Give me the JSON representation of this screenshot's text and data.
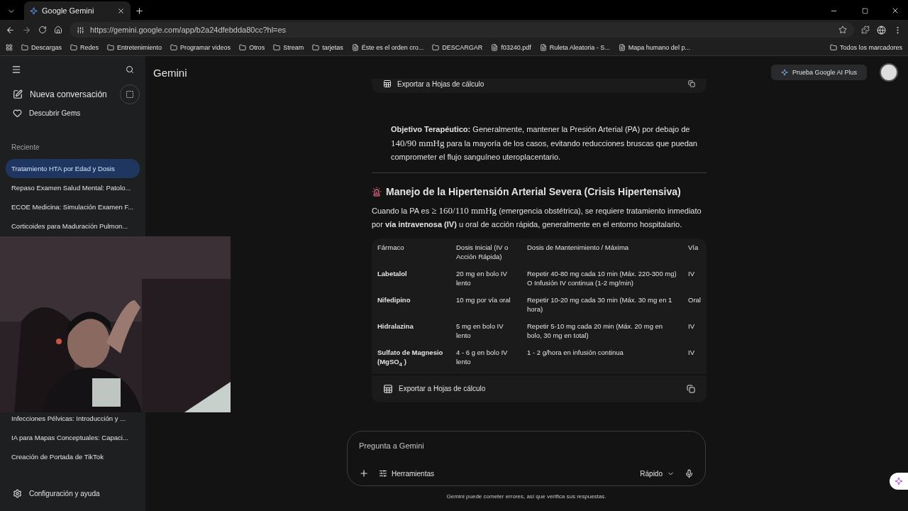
{
  "browser": {
    "tab_title": "Google Gemini",
    "url": "https://gemini.google.com/app/b2a24dfebdda80cc?hl=es",
    "bookmarks": [
      {
        "label": "Descargas",
        "kind": "folder"
      },
      {
        "label": "Redes",
        "kind": "folder"
      },
      {
        "label": "Entretenimiento",
        "kind": "folder"
      },
      {
        "label": "Programar videos",
        "kind": "folder"
      },
      {
        "label": "Otros",
        "kind": "folder"
      },
      {
        "label": "Stream",
        "kind": "folder"
      },
      {
        "label": "tarjetas",
        "kind": "folder"
      },
      {
        "label": "Éste es el orden cro...",
        "kind": "page"
      },
      {
        "label": "DESCARGAR",
        "kind": "folder"
      },
      {
        "label": "f03240.pdf",
        "kind": "page"
      },
      {
        "label": "Ruleta Aleatoria - S...",
        "kind": "page"
      },
      {
        "label": "Mapa humano del p...",
        "kind": "page"
      }
    ],
    "all_bookmarks": "Todos los marcadores"
  },
  "sidebar": {
    "new_chat": "Nueva conversación",
    "discover": "Descubrir Gems",
    "recent_label": "Reciente",
    "recent": [
      {
        "title": "Tratamiento HTA por Edad y Dosis",
        "selected": true
      },
      {
        "title": "Repaso Examen Salud Mental: Patolo...",
        "selected": false
      },
      {
        "title": "ECOE Medicina: Simulación Examen F...",
        "selected": false
      },
      {
        "title": "Corticoides para Maduración Pulmon...",
        "selected": false
      },
      {
        "title": "Infecciones Pélvicas: Introducción y ...",
        "selected": false
      },
      {
        "title": "IA para Mapas Conceptuales: Capaci...",
        "selected": false
      },
      {
        "title": "Creación de Portada de TikTok",
        "selected": false
      }
    ],
    "settings": "Configuración y ayuda"
  },
  "header": {
    "title": "Gemini",
    "upgrade": "Prueba Google AI Plus"
  },
  "content": {
    "export_top": "Exportar a Hojas de cálculo",
    "objective": [
      {
        "kind": "bold",
        "text": "Objetivo Terapéutico:"
      },
      {
        "kind": "text",
        "text": " Generalmente, mantener la Presión Arterial (PA) por debajo de "
      },
      {
        "kind": "math",
        "text": "140/90 mmHg"
      },
      {
        "kind": "text",
        "text": " para la mayoría de los casos, evitando reducciones bruscas que puedan comprometer el flujo sanguíneo uteroplacentario."
      }
    ],
    "heading": "Manejo de la Hipertensión Arterial Severa (Crisis Hipertensiva)",
    "intro": [
      {
        "kind": "text",
        "text": "Cuando la PA es "
      },
      {
        "kind": "math",
        "text": "≥ 160/110 mmHg"
      },
      {
        "kind": "text",
        "text": " (emergencia obstétrica), se requiere tratamiento inmediato por "
      },
      {
        "kind": "bold",
        "text": "vía intravenosa (IV)"
      },
      {
        "kind": "text",
        "text": " u oral de acción rápida, generalmente en el entorno hospitalario."
      }
    ],
    "table": {
      "columns": [
        "Fármaco",
        "Dosis Inicial (IV o Acción Rápida)",
        "Dosis de Mantenimiento / Máxima",
        "Vía"
      ],
      "rows": [
        [
          "Labetalol",
          "20 mg en bolo IV lento",
          "Repetir 40-80 mg cada 10 min (Máx. 220-300 mg) O Infusión IV continua (1-2 mg/min)",
          "IV"
        ],
        [
          "Nifedipino",
          "10 mg por vía oral",
          "Repetir 10-20 mg cada 30 min (Máx. 30 mg en 1 hora)",
          "Oral"
        ],
        [
          "Hidralazina",
          "5 mg en bolo IV lento",
          "Repetir 5-10 mg cada 20 min (Máx. 20 mg en bolo, 30 mg en total)",
          "IV"
        ],
        [
          "Sulfato de Magnesio (MgSO$_{4}$ )",
          "4 - 6 g en bolo IV lento",
          "1 - 2 g/hora en infusión continua",
          "IV"
        ]
      ]
    },
    "export": "Exportar a Hojas de cálculo"
  },
  "input": {
    "placeholder": "Pregunta a Gemini",
    "tools": "Herramientas",
    "mode": "Rápido",
    "disclaimer": "Gemini puede cometer errores, así que verifica sus respuestas."
  }
}
